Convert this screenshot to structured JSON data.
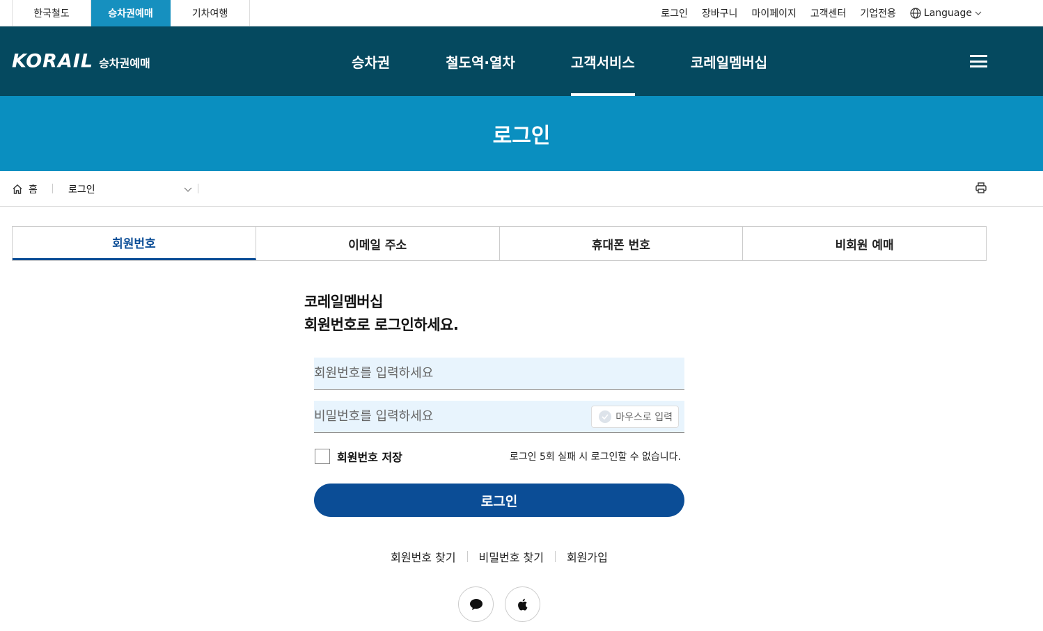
{
  "site_tabs": [
    "한국철도",
    "승차권예매",
    "기차여행"
  ],
  "util_links": [
    "로그인",
    "장바구니",
    "마이페이지",
    "고객센터",
    "기업전용"
  ],
  "language_label": "Language",
  "logo": {
    "word": "KORAIL",
    "sub": "승차권예매"
  },
  "nav": [
    "승차권",
    "철도역·열차",
    "고객서비스",
    "코레일멤버십"
  ],
  "banner_title": "로그인",
  "breadcrumb": {
    "home": "홈",
    "current": "로그인"
  },
  "login_tabs": [
    "회원번호",
    "이메일 주소",
    "휴대폰 번호",
    "비회원 예매"
  ],
  "form": {
    "heading_line1": "코레일멤버십",
    "heading_line2": "회원번호로 로그인하세요.",
    "member_placeholder": "회원번호를 입력하세요",
    "password_placeholder": "비밀번호를 입력하세요",
    "mouse_input_label": "마우스로 입력",
    "save_label": "회원번호 저장",
    "notice": "로그인 5회 실패 시 로그인할 수 없습니다.",
    "login_button": "로그인"
  },
  "links": [
    "회원번호 찾기",
    "비밀번호 찾기",
    "회원가입"
  ],
  "colors": {
    "nav_bg": "#05495f",
    "banner_bg": "#0a8fc0",
    "primary": "#0b4d96",
    "field_bg": "#e8f4fd"
  }
}
